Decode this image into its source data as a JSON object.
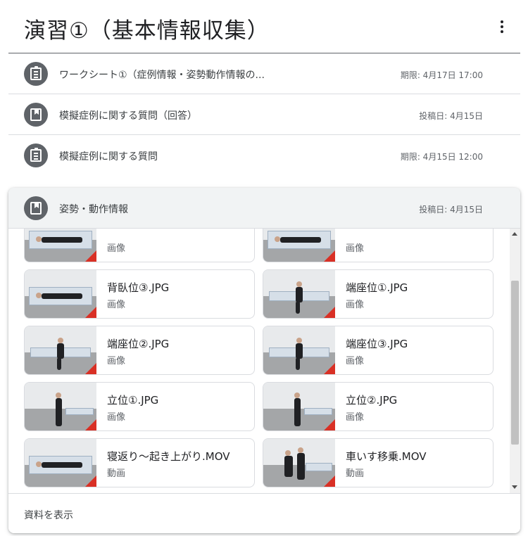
{
  "header": {
    "title": "演習①（基本情報収集）"
  },
  "items": [
    {
      "title": "ワークシート①（症例情報・姿勢動作情報の...",
      "date": "期限: 4月17日 17:00",
      "icon": "assignment-icon"
    },
    {
      "title": "模擬症例に関する質問（回答）",
      "date": "投稿日: 4月15日",
      "icon": "material-icon"
    },
    {
      "title": "模擬症例に関する質問",
      "date": "期限: 4月15日 12:00",
      "icon": "assignment-icon"
    }
  ],
  "expanded": {
    "title": "姿勢・動作情報",
    "date": "投稿日: 4月15日",
    "icon": "material-icon",
    "footer_label": "資料を表示",
    "attachments": [
      {
        "name": "",
        "type": "画像",
        "scene": "lying"
      },
      {
        "name": "",
        "type": "画像",
        "scene": "lying"
      },
      {
        "name": "背臥位③.JPG",
        "type": "画像",
        "scene": "lying"
      },
      {
        "name": "端座位①.JPG",
        "type": "画像",
        "scene": "sitting"
      },
      {
        "name": "端座位②.JPG",
        "type": "画像",
        "scene": "sitting"
      },
      {
        "name": "端座位③.JPG",
        "type": "画像",
        "scene": "sitting"
      },
      {
        "name": "立位①.JPG",
        "type": "画像",
        "scene": "standing"
      },
      {
        "name": "立位②.JPG",
        "type": "画像",
        "scene": "standing"
      },
      {
        "name": "寝返り～起き上がり.MOV",
        "type": "動画",
        "scene": "lying"
      },
      {
        "name": "車いす移乗.MOV",
        "type": "動画",
        "scene": "wheelchair"
      },
      {
        "name": "",
        "type": "",
        "scene": "standing"
      },
      {
        "name": "",
        "type": "",
        "scene": "standing"
      }
    ]
  },
  "colors": {
    "icon_bg": "#5f6368",
    "thumb_corner": "#d93025",
    "expanded_bg": "#f1f3f4"
  }
}
